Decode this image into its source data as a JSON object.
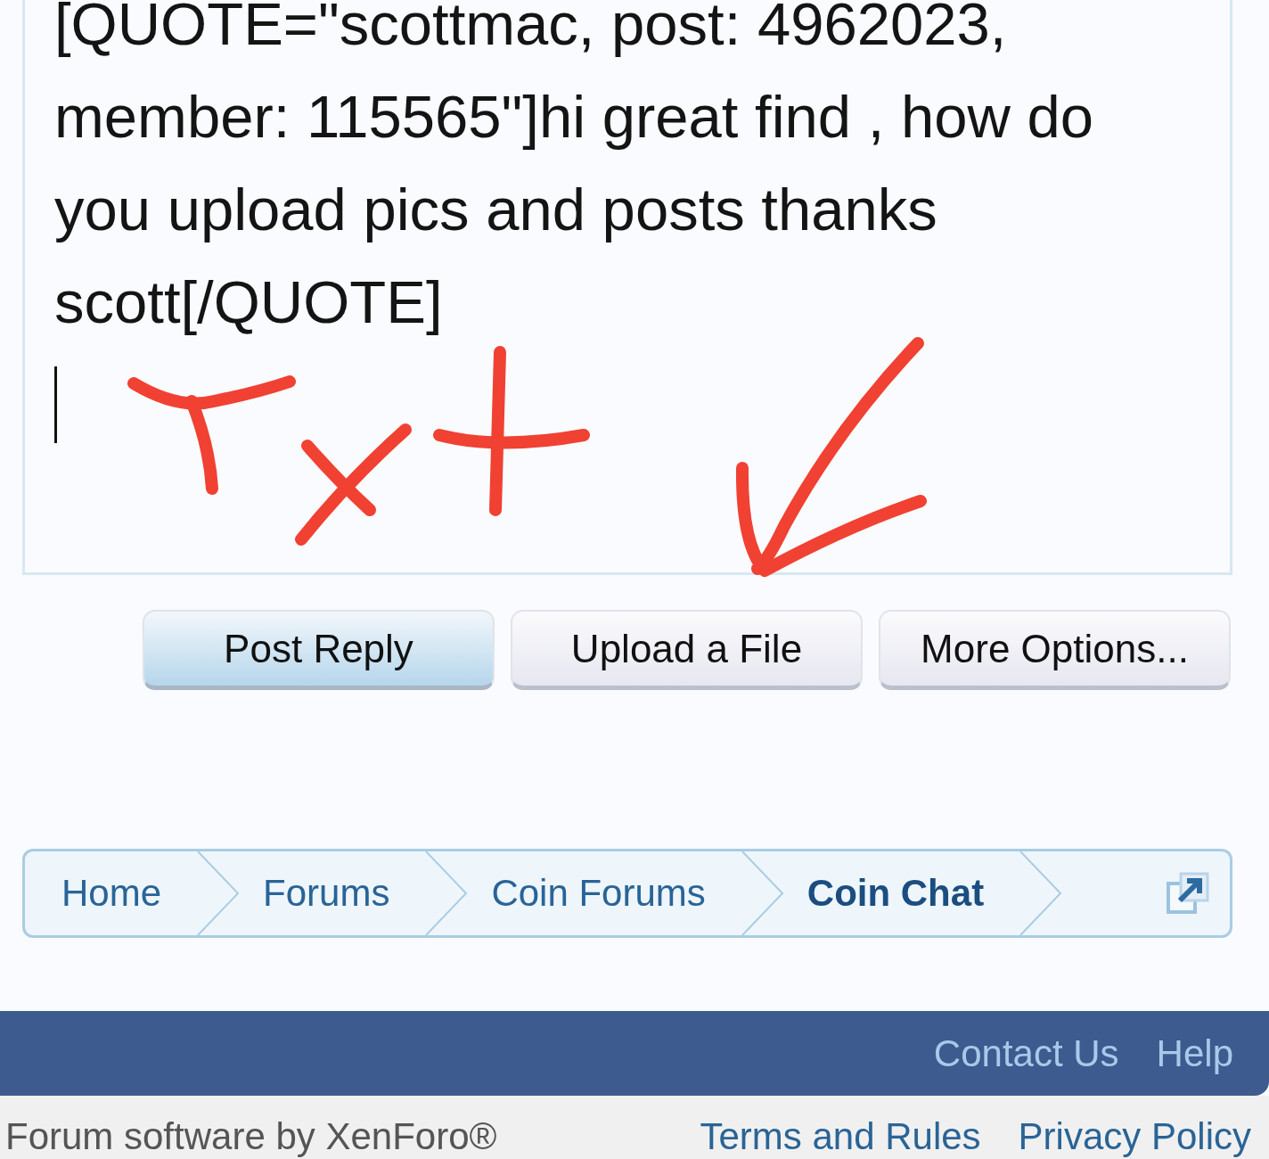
{
  "editor": {
    "value": "[QUOTE=\"scottmac, post: 4962023,\nmember: 115565\"]hi great find , how do\nyou upload pics and posts thanks\nscott[/QUOTE]"
  },
  "buttons": [
    {
      "label": "Post Reply",
      "kind": "primary"
    },
    {
      "label": "Upload a File",
      "kind": "secondary"
    },
    {
      "label": "More Options...",
      "kind": "secondary"
    }
  ],
  "breadcrumb": [
    {
      "label": "Home",
      "selected": false
    },
    {
      "label": "Forums",
      "selected": false
    },
    {
      "label": "Coin Forums",
      "selected": false
    },
    {
      "label": "Coin Chat",
      "selected": true
    }
  ],
  "footer": {
    "links": [
      "Contact Us",
      "Help"
    ],
    "copyright": "Forum software by XenForo®",
    "legal_links": [
      "Terms and Rules",
      "Privacy Policy"
    ]
  }
}
